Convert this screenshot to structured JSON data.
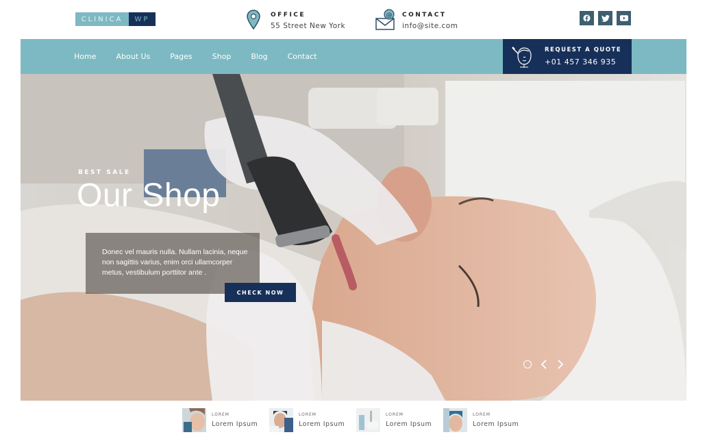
{
  "logo": {
    "part1": "CLINICA",
    "part2": "WP"
  },
  "header": {
    "office": {
      "title": "OFFICE",
      "value": "55 Street New York",
      "icon": "map-pin-icon"
    },
    "contact": {
      "title": "CONTACT",
      "value": "info@site.com",
      "icon": "mail-icon"
    },
    "socials": [
      "facebook-icon",
      "twitter-icon",
      "youtube-icon"
    ]
  },
  "nav": {
    "items": [
      "Home",
      "About Us",
      "Pages",
      "Shop",
      "Blog",
      "Contact"
    ],
    "quote": {
      "title": "REQUEST A QUOTE",
      "phone": "+01 457 346 935",
      "icon": "face-treatment-icon"
    }
  },
  "hero": {
    "subtitle": "BEST SALE",
    "title": "Our Shop",
    "text": "Donec vel mauris nulla. Nullam lacinia, neque non sagittis varius, enim orci ullamcorper metus, vestibulum porttitor ante .",
    "button": "CHECK NOW"
  },
  "thumbnails": [
    {
      "label": "LOREM",
      "title": "Lorem Ipsum"
    },
    {
      "label": "LOREM",
      "title": "Lorem Ipsum"
    },
    {
      "label": "LOREM",
      "title": "Lorem Ipsum"
    },
    {
      "label": "LOREM",
      "title": "Lorem Ipsum"
    }
  ],
  "colors": {
    "accent": "#7db9c2",
    "navy": "#17305a",
    "social": "#3d5f70"
  }
}
